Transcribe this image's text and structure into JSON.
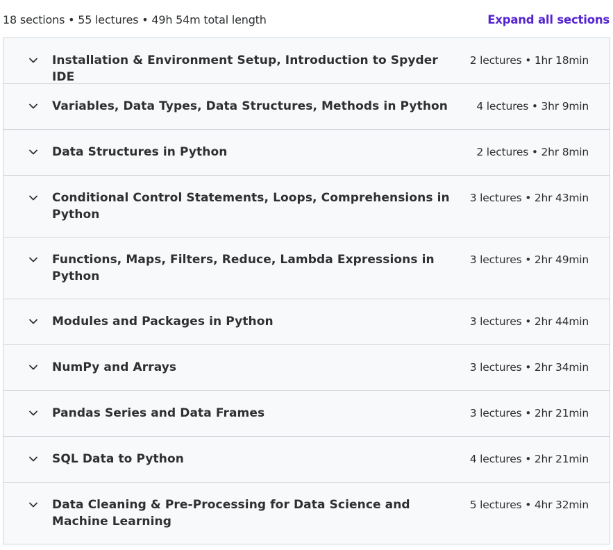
{
  "summary": {
    "text": "18 sections • 55 lectures • 49h 54m total length",
    "expand_label": "Expand all sections"
  },
  "icons": {
    "section_toggle": "chevron-down-icon"
  },
  "colors": {
    "link": "#5624d0",
    "text": "#2d2f31",
    "panel_bg": "#f7f9fa",
    "border": "#d1d7dc"
  },
  "sections": [
    {
      "title": "Installation & Environment Setup, Introduction to Spyder IDE",
      "meta": "2 lectures • 1hr 18min"
    },
    {
      "title": "Variables, Data Types, Data Structures, Methods in Python",
      "meta": "4 lectures • 3hr 9min"
    },
    {
      "title": "Data Structures in Python",
      "meta": "2 lectures • 2hr 8min"
    },
    {
      "title": "Conditional Control Statements, Loops, Comprehensions in Python",
      "meta": "3 lectures • 2hr 43min"
    },
    {
      "title": "Functions, Maps, Filters, Reduce, Lambda Expressions in Python",
      "meta": "3 lectures • 2hr 49min"
    },
    {
      "title": "Modules and Packages in Python",
      "meta": "3 lectures • 2hr 44min"
    },
    {
      "title": "NumPy and Arrays",
      "meta": "3 lectures • 2hr 34min"
    },
    {
      "title": "Pandas Series and Data Frames",
      "meta": "3 lectures • 2hr 21min"
    },
    {
      "title": "SQL Data to Python",
      "meta": "4 lectures • 2hr 21min"
    },
    {
      "title": "Data Cleaning & Pre-Processing for Data Science and Machine Learning",
      "meta": "5 lectures • 4hr 32min"
    }
  ]
}
